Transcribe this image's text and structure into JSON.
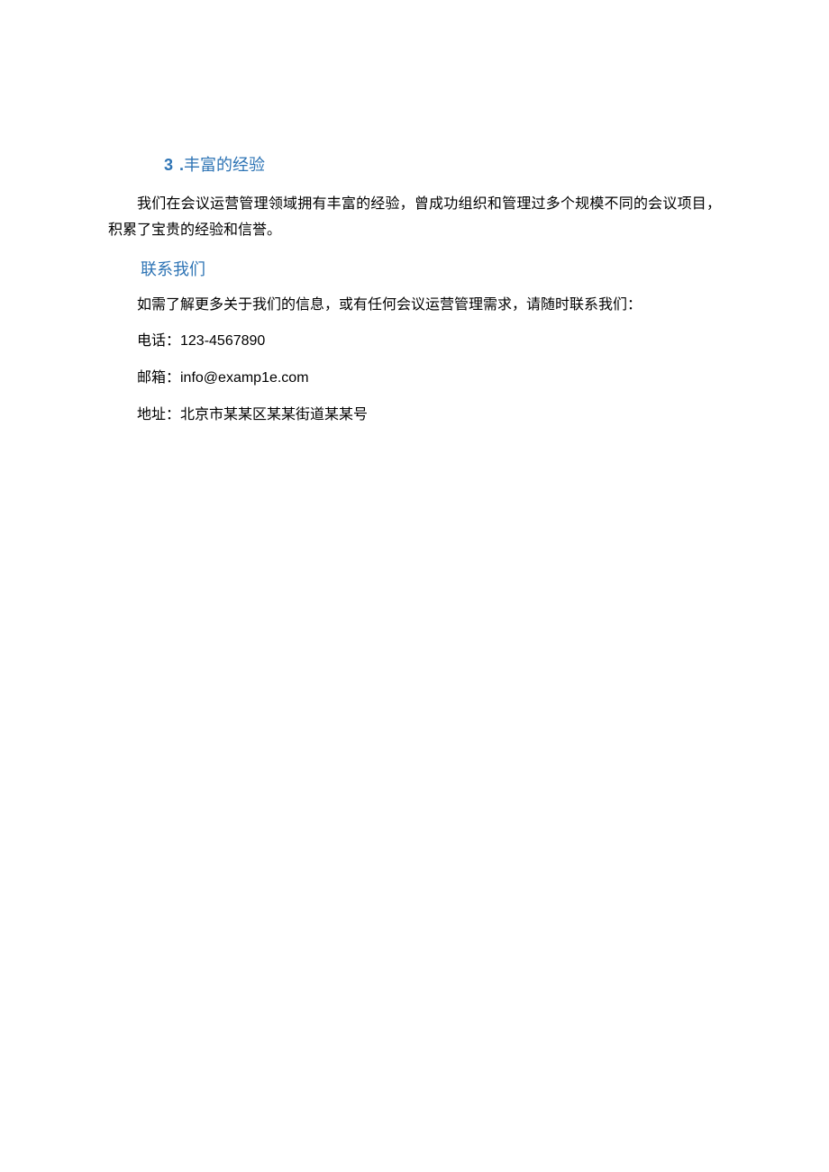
{
  "section3": {
    "number": "3",
    "period": "  .",
    "title": "丰富的经验",
    "body": "我们在会议运营管理领域拥有丰富的经验，曾成功组织和管理过多个规模不同的会议项目，积累了宝贵的经验和信誉。"
  },
  "contact": {
    "heading": "联系我们",
    "intro": "如需了解更多关于我们的信息，或有任何会议运营管理需求，请随时联系我们：",
    "phone": "电话：123-4567890",
    "email": "邮箱：info@examp1e.com",
    "address": "地址：北京市某某区某某街道某某号"
  }
}
